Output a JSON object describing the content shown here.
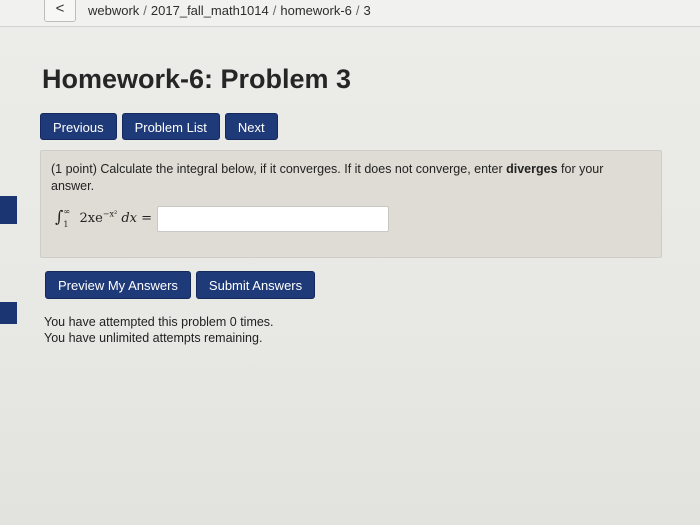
{
  "breadcrumb": {
    "back_label": "<",
    "items": [
      "webwork",
      "2017_fall_math1014",
      "homework-6",
      "3"
    ],
    "separator": "/"
  },
  "page": {
    "title": "Homework-6: Problem 3"
  },
  "nav": {
    "previous_label": "Previous",
    "problem_list_label": "Problem List",
    "next_label": "Next"
  },
  "problem": {
    "points": "(1 point)",
    "text_before": " Calculate the integral below, if it converges. If it does not converge, enter ",
    "keyword": "diverges",
    "text_after": " for your answer.",
    "formula": {
      "upper_limit": "∞",
      "lower_limit": "1",
      "integrand": "2xe",
      "exponent": "−x²",
      "differential": "dx =",
      "integral_symbol": "∫"
    },
    "answer_value": ""
  },
  "actions": {
    "preview_label": "Preview My Answers",
    "submit_label": "Submit Answers"
  },
  "status": {
    "attempts_line": "You have attempted this problem 0 times.",
    "remaining_line": "You have unlimited attempts remaining."
  },
  "colors": {
    "button_bg": "#1f3a78",
    "problem_bg": "#dedcd5",
    "page_bg": "#e9e9e6"
  }
}
